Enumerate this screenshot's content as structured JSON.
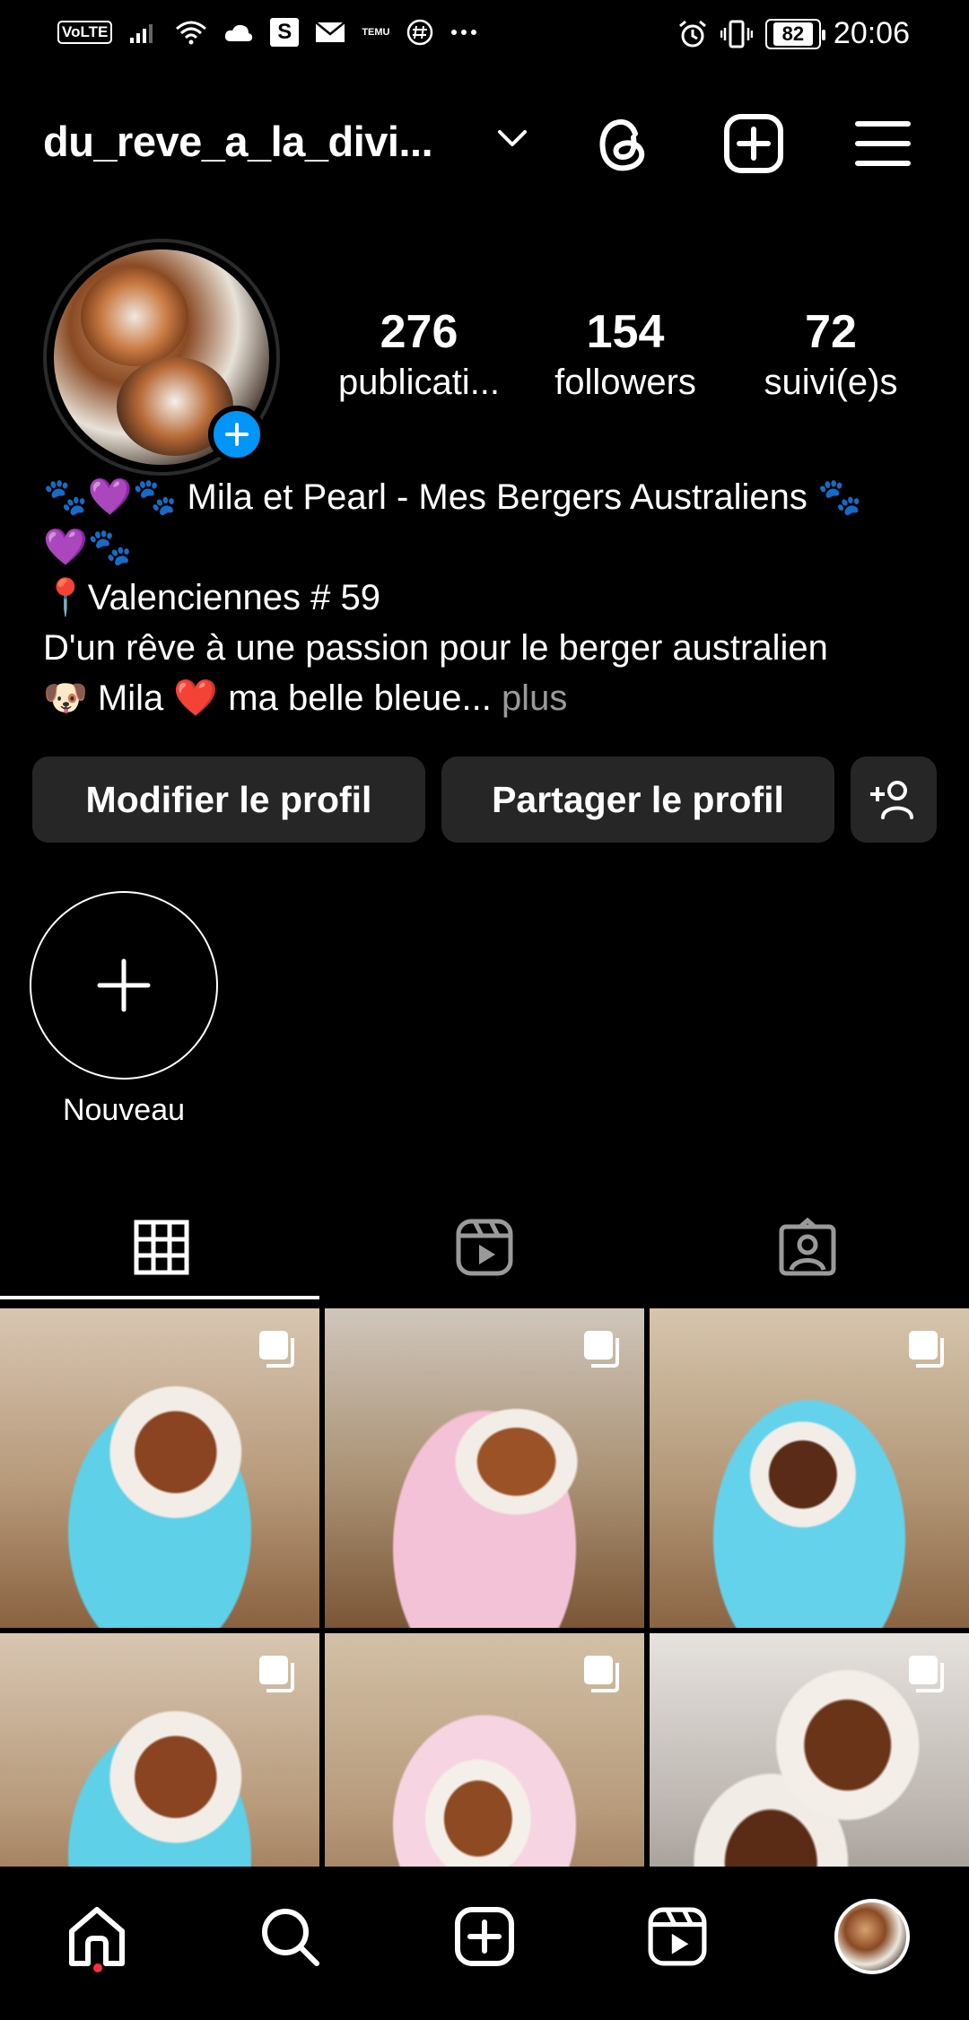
{
  "status_bar": {
    "volte": "VoLTE",
    "s_badge": "S",
    "temu": "TEMU",
    "battery": "82",
    "time": "20:06"
  },
  "header": {
    "username": "du_reve_a_la_divi..."
  },
  "profile": {
    "stats": [
      {
        "value": "276",
        "label": "publicati..."
      },
      {
        "value": "154",
        "label": "followers"
      },
      {
        "value": "72",
        "label": "suivi(e)s"
      }
    ],
    "bio_lines": [
      "🐾💜🐾 Mila et Pearl - Mes Bergers Australiens 🐾",
      "💜🐾",
      "📍Valenciennes # 59",
      "D'un rêve à une passion pour le berger australien",
      "🐶 Mila ❤️  ma belle bleue..."
    ],
    "more_label": "plus"
  },
  "buttons": {
    "edit": "Modifier le profil",
    "share": "Partager le profil"
  },
  "highlight": {
    "new_label": "Nouveau"
  },
  "icons": {
    "threads": "threads-icon",
    "create": "plus-square-icon",
    "menu": "hamburger-menu-icon",
    "grid": "grid-icon",
    "reels": "reels-icon",
    "tagged": "tagged-icon",
    "home": "home-icon",
    "search": "search-icon",
    "add_user": "add-user-icon",
    "carousel": "carousel-icon"
  },
  "colors": {
    "accent_blue": "#0095f6",
    "notification_red": "#ff3040",
    "button_bg": "#262626"
  }
}
